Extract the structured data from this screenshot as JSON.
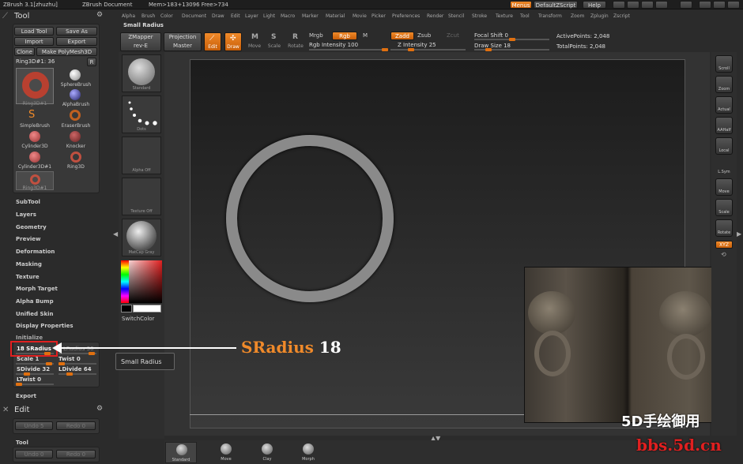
{
  "titlebar": {
    "app": "ZBrush 3.1[zhuzhu]",
    "doc": "ZBrush Document",
    "mem": "Mem>183+13096 Free>734",
    "menus": "Menus",
    "script": "DefaultZScript",
    "help": "Help"
  },
  "menubar": [
    "Alpha",
    "Brush",
    "Color",
    "Document",
    "Draw",
    "Edit",
    "Layer",
    "Light",
    "Macro",
    "Marker",
    "Material",
    "Movie",
    "Picker",
    "Preferences",
    "Render",
    "Stencil",
    "Stroke",
    "Texture",
    "Tool",
    "Transform",
    "Zoom",
    "Zplugin",
    "Zscript"
  ],
  "tool": {
    "title": "Tool",
    "load": "Load Tool",
    "save": "Save As",
    "import": "Import",
    "export": "Export",
    "clone": "Clone",
    "make": "Make PolyMesh3D",
    "current": "Ring3D#1: 36",
    "r": "R",
    "brushes": [
      {
        "label": "Ring3D#1"
      },
      {
        "label": "SphereBrush"
      },
      {
        "label": "AlphaBrush"
      },
      {
        "label": "SimpleBrush"
      },
      {
        "label": "EraserBrush"
      },
      {
        "label": "Cylinder3D"
      },
      {
        "label": "Knocker"
      },
      {
        "label": "Cylinder3D#1"
      },
      {
        "label": "Ring3D"
      },
      {
        "label": "Ring3D#1"
      }
    ]
  },
  "left_menu": [
    "SubTool",
    "Layers",
    "Geometry",
    "Preview",
    "Deformation",
    "Masking",
    "Texture",
    "Morph Target",
    "Alpha Bump",
    "Unified Skin",
    "Display Properties",
    "Initialize"
  ],
  "init": {
    "sradius": "18 SRadius",
    "lrad": "LRadius 36",
    "scale": "Scale 1",
    "twist": "Twist 0",
    "sdivide": "SDivide 32",
    "ldivide": "LDivide 64",
    "ltwist": "LTwist 0",
    "export": "Export"
  },
  "edit": {
    "title": "Edit",
    "undo": "Undo 5",
    "redo": "Redo 0",
    "tool": "Tool",
    "undo2": "Undo 0",
    "redo2": "Redo 0"
  },
  "top": {
    "label": "Small Radius",
    "zmapper": "ZMapper",
    "zmapper2": "rev-E",
    "projection": "Projection",
    "master": "Master",
    "edit": "Edit",
    "draw": "Draw",
    "move": "Move",
    "scale": "Scale",
    "rotate": "Rotate",
    "mrgb": "Mrgb",
    "rgb": "Rgb",
    "m": "M",
    "zadd": "Zadd",
    "zsub": "Zsub",
    "zcut": "Zcut",
    "rgbint": "Rgb Intensity 100",
    "zint": "Z Intensity 25",
    "focal": "Focal Shift 0",
    "drawsize": "Draw Size 18",
    "active": "ActivePoints: 2,048",
    "total": "TotalPoints: 2,048"
  },
  "shelf": {
    "standard": "Standard",
    "dots": "Dots",
    "alpha": "Alpha Off",
    "texture": "Texture Off",
    "matcap": "MatCap Gray",
    "switch": "SwitchColor"
  },
  "right": [
    "Scroll",
    "Zoom",
    "Actual",
    "AAHalf",
    "Local",
    "L.Sym",
    "Move",
    "Scale",
    "Rotate",
    "XYZ"
  ],
  "bottom": [
    "Standard",
    "Move",
    "Clay",
    "Morph"
  ],
  "tooltip": "Small Radius",
  "annotation": {
    "name": "SRadius",
    "value": "18"
  },
  "watermark": {
    "line1": "5D手绘御用",
    "line2": "bbs.5d.cn"
  }
}
